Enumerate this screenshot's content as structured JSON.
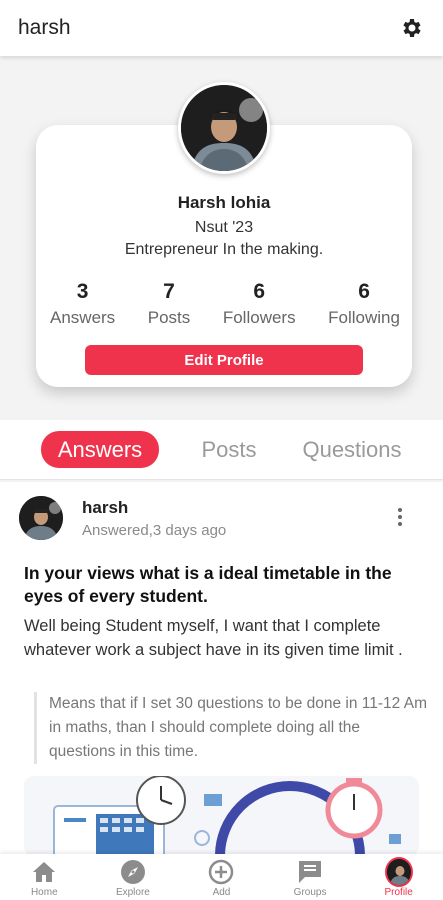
{
  "header": {
    "title": "harsh"
  },
  "profile": {
    "name": "Harsh lohia",
    "school": "Nsut '23",
    "bio": "Entrepreneur In the making.",
    "stats": [
      {
        "num": "3",
        "label": "Answers"
      },
      {
        "num": "7",
        "label": "Posts"
      },
      {
        "num": "6",
        "label": "Followers"
      },
      {
        "num": "6",
        "label": "Following"
      }
    ],
    "edit_label": "Edit Profile"
  },
  "tabs": [
    {
      "label": "Answers",
      "active": true
    },
    {
      "label": "Posts",
      "active": false
    },
    {
      "label": "Questions",
      "active": false
    }
  ],
  "post": {
    "author": "harsh",
    "meta": "Answered,3 days ago",
    "question": "In your views what is a ideal timetable in the eyes of every student.",
    "answer": "Well being Student myself, I want that I complete whatever work a subject have in its given time limit .",
    "quote": "Means that if I set 30 questions to be done in 11-12 Am in maths, than I should complete doing all the questions in this time."
  },
  "nav": [
    {
      "label": "Home",
      "icon": "home-icon"
    },
    {
      "label": "Explore",
      "icon": "compass-icon"
    },
    {
      "label": "Add",
      "icon": "add-circle-icon"
    },
    {
      "label": "Groups",
      "icon": "chat-icon"
    },
    {
      "label": "Profile",
      "icon": "avatar"
    }
  ],
  "colors": {
    "accent": "#f0334d",
    "background": "#f3f3f3"
  }
}
